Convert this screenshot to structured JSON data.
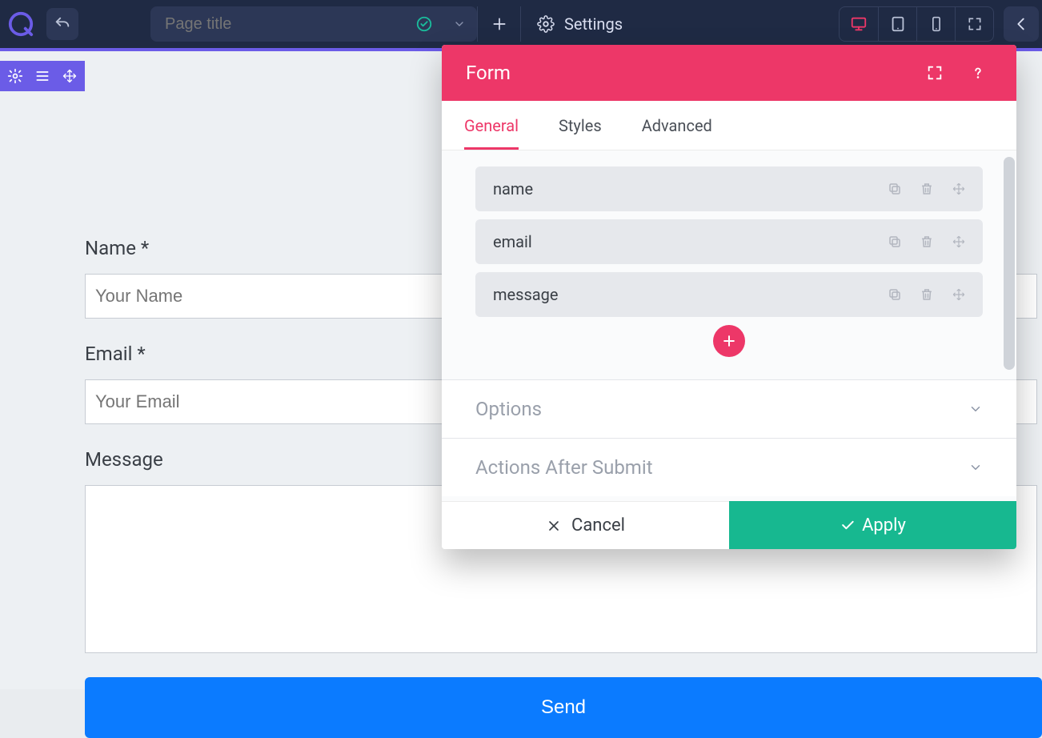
{
  "topbar": {
    "page_title_placeholder": "Page title",
    "settings_label": "Settings"
  },
  "form": {
    "name_label": "Name *",
    "name_placeholder": "Your Name",
    "email_label": "Email *",
    "email_placeholder": "Your Email",
    "message_label": "Message",
    "send_label": "Send"
  },
  "panel": {
    "title": "Form",
    "tabs": {
      "general": "General",
      "styles": "Styles",
      "advanced": "Advanced"
    },
    "fields": [
      "name",
      "email",
      "message"
    ],
    "sections": {
      "options": "Options",
      "actions": "Actions After Submit"
    },
    "cancel": "Cancel",
    "apply": "Apply"
  }
}
